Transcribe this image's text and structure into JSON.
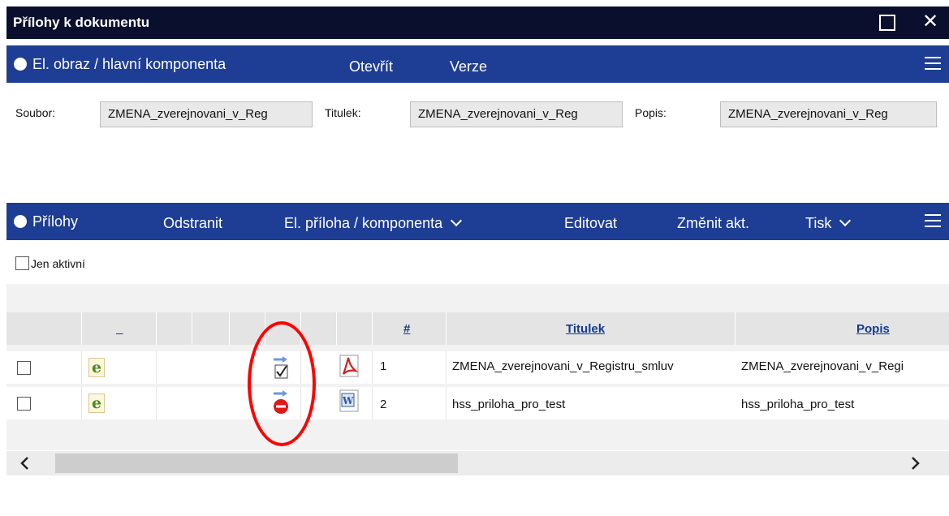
{
  "window": {
    "title": "Přílohy k dokumentu",
    "maximize_icon": "square-icon",
    "close_icon": "close-icon"
  },
  "main_section": {
    "title": "El. obraz / hlavní komponenta",
    "buttons": [
      "Otevřít",
      "Verze"
    ]
  },
  "fields": {
    "soubor_label": "Soubor:",
    "soubor_value": "ZMENA_zverejnovani_v_Reg",
    "titulek_label": "Titulek:",
    "titulek_value": "ZMENA_zverejnovani_v_Reg",
    "popis_label": "Popis:",
    "popis_value": "ZMENA_zverejnovani_v_Reg"
  },
  "attachments_section": {
    "title": "Přílohy",
    "buttons": [
      "Odstranit",
      "El. příloha / komponenta",
      "Editovat",
      "Změnit akt.",
      "Tisk"
    ]
  },
  "filter": {
    "only_active_label": "Jen aktivní",
    "only_active_checked": false
  },
  "table": {
    "columns": {
      "col_underscore": "_",
      "number": "#",
      "titulek": "Titulek",
      "popis": "Popis"
    },
    "rows": [
      {
        "checked": false,
        "type_icon": "e-document-icon",
        "status_icon": "signed-check-icon",
        "file_icon": "pdf-icon",
        "number": "1",
        "titulek": "ZMENA_zverejnovani_v_Registru_smluv",
        "popis": "ZMENA_zverejnovani_v_Regi"
      },
      {
        "checked": false,
        "type_icon": "e-document-icon",
        "status_icon": "not-allowed-icon",
        "file_icon": "word-doc-icon",
        "number": "2",
        "titulek": "hss_priloha_pro_test",
        "popis": "hss_priloha_pro_test"
      }
    ]
  },
  "scrollbar": {
    "left_icon": "chevron-left-icon",
    "right_icon": "chevron-right-icon",
    "position": 0
  },
  "colors": {
    "title_bar": "#0a0f2e",
    "section_bar": "#1e3d94",
    "link": "#123b8c",
    "annotation": "#ff0000"
  }
}
